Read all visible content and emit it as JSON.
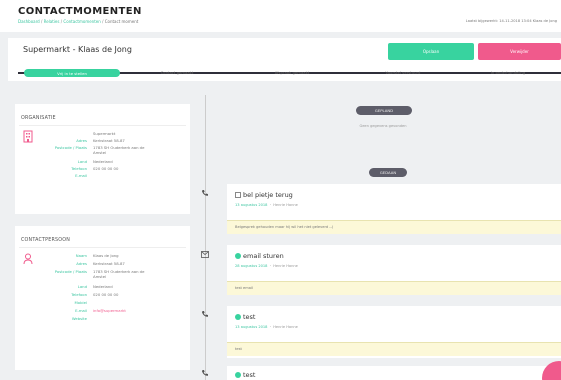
{
  "header": {
    "title": "CONTACTMOMENTEN",
    "breadcrumb": {
      "items": [
        "Dashboard",
        "Relaties",
        "Contactmomenten"
      ],
      "separator": "/",
      "current": "Contact moment"
    },
    "last_updated": "Laatst bijgewerkt: 14-11-2018 13:04 Klaas de Jong"
  },
  "page": {
    "title": "Supermarkt - Klaas de Jong",
    "primary_button": "Opslaan",
    "secondary_button": "Verwijder"
  },
  "steps": [
    {
      "label": "Vrij in te stellen",
      "active": true
    },
    {
      "label": "Contact gemaakt",
      "active": false
    },
    {
      "label": "Afspraak gemaakt",
      "active": false
    },
    {
      "label": "Voorstel verstuurd",
      "active": false
    },
    {
      "label": "In onderhandeling",
      "active": false
    }
  ],
  "organisation": {
    "title": "ORGANISATIE",
    "icon": "building-icon",
    "rows": [
      {
        "label": "",
        "value": "Supermarkt"
      },
      {
        "label": "Adres",
        "value": "Kerkstraat 58-87"
      },
      {
        "label": "Postcode / Plaats",
        "value": "1783 SH Ouderkerk aan de Amstel"
      },
      {
        "label": "Land",
        "value": "Nederland"
      },
      {
        "label": "Telefoon",
        "value": "020 00 00 00"
      },
      {
        "label": "E-mail",
        "value": ""
      }
    ]
  },
  "contact_person": {
    "title": "CONTACTPERSOON",
    "icon": "person-icon",
    "rows": [
      {
        "label": "Naam",
        "value": "Klaas de Jong"
      },
      {
        "label": "Adres",
        "value": "Kerkstraat 58-87"
      },
      {
        "label": "Postcode / Plaats",
        "value": "1783 SH Ouderkerk aan de Amstel"
      },
      {
        "label": "Land",
        "value": "Nederland"
      },
      {
        "label": "Telefoon",
        "value": "020 00 00 00"
      },
      {
        "label": "Mobiel",
        "value": ""
      },
      {
        "label": "E-mail",
        "value": "info@supermarkt"
      },
      {
        "label": "Website",
        "value": ""
      }
    ]
  },
  "timeline": {
    "planned_label": "GEPLAND",
    "no_data": "Geen gegevens gevonden",
    "done_label": "GEDAAN",
    "items": [
      {
        "icon": "phone-icon",
        "tag": "checkbox",
        "title": "bel pietje terug",
        "date": "13 augustus 2018",
        "person": "Henrie Hanne",
        "note": "Belgesprek gehouden maar hij wil het niet geleverd --)"
      },
      {
        "icon": "envelope-icon",
        "tag": "dot",
        "title": "email sturen",
        "date": "28 augustus 2018",
        "person": "Henrie Hanne",
        "note": "test email"
      },
      {
        "icon": "phone-icon",
        "tag": "dot",
        "title": "test",
        "date": "13 augustus 2018",
        "person": "Henrie Hanne",
        "note": "test"
      },
      {
        "icon": "phone-icon",
        "tag": "dot",
        "title": "test",
        "date": "",
        "person": "",
        "note": ""
      }
    ]
  },
  "colors": {
    "accent_green": "#38d39f",
    "accent_pink": "#f05a8c",
    "dark_step_line": "#2f2f3a",
    "note_background": "#fcf8d8"
  }
}
